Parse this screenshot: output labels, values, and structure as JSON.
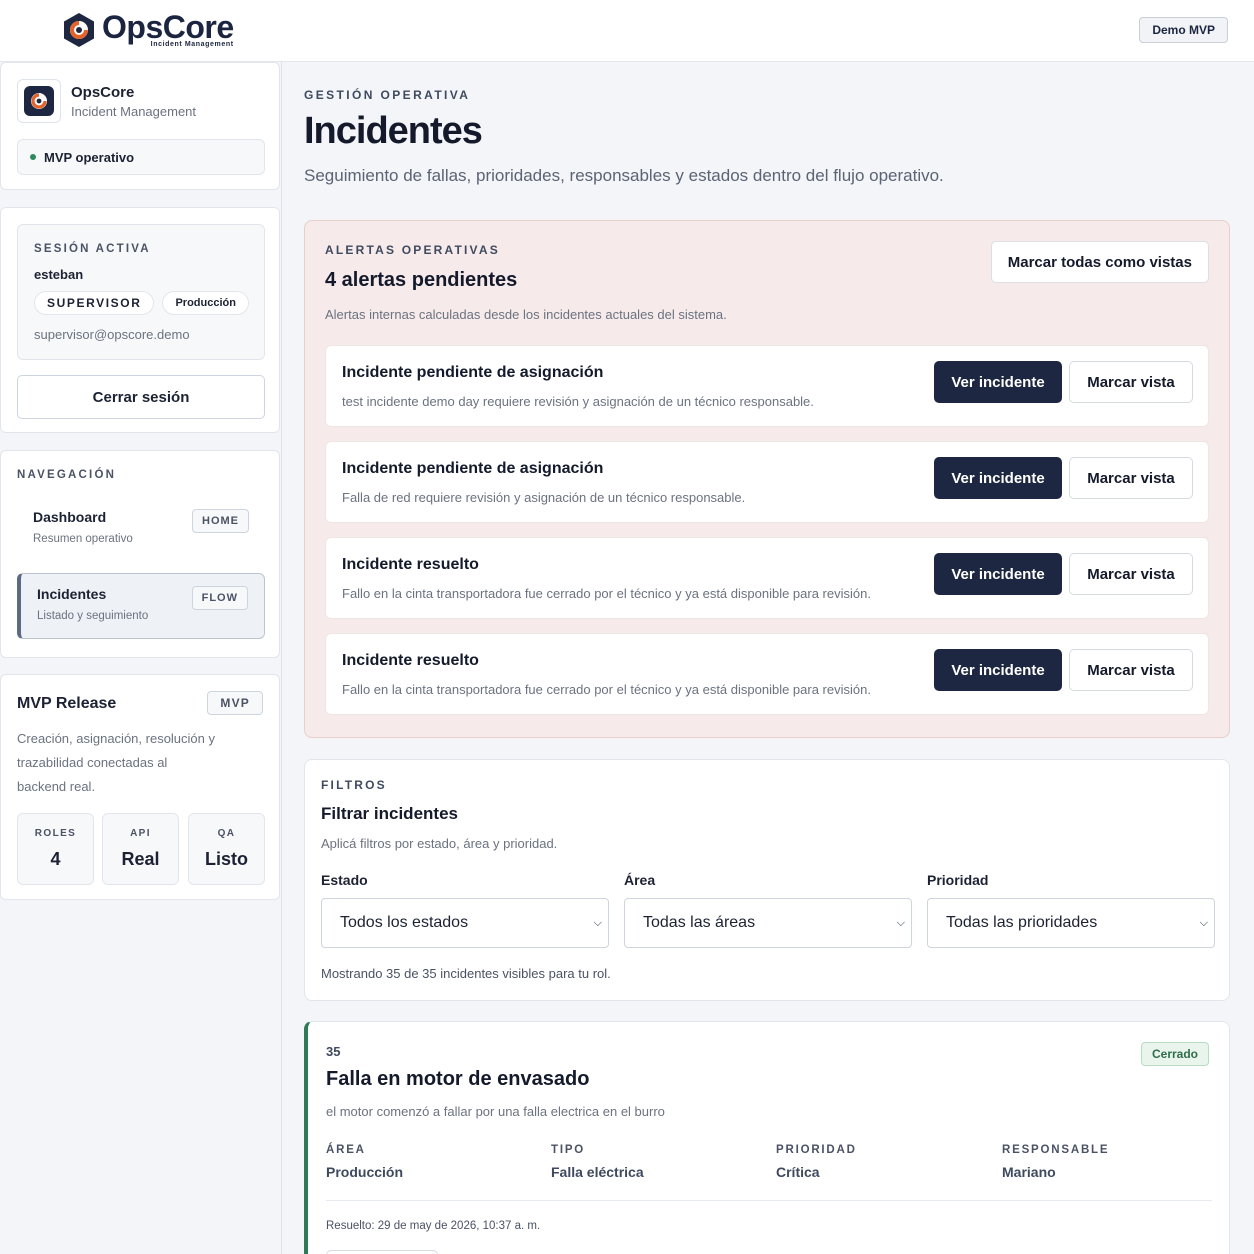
{
  "topbar": {
    "brand_name": "OpsCore",
    "brand_sub": "Incident Management",
    "demo_label": "Demo MVP"
  },
  "sidebar": {
    "app": {
      "name": "OpsCore",
      "desc": "Incident Management",
      "status": "MVP operativo"
    },
    "session": {
      "eyebrow": "SESIÓN ACTIVA",
      "user": "esteban",
      "role": "SUPERVISOR",
      "area": "Producción",
      "email": "supervisor@opscore.demo",
      "logout_label": "Cerrar sesión"
    },
    "nav": {
      "eyebrow": "NAVEGACIÓN",
      "items": [
        {
          "title": "Dashboard",
          "sub": "Resumen operativo",
          "badge": "HOME"
        },
        {
          "title": "Incidentes",
          "sub": "Listado y seguimiento",
          "badge": "FLOW"
        }
      ]
    },
    "release": {
      "title": "MVP Release",
      "badge": "MVP",
      "desc": "Creación, asignación, resolución y trazabilidad conectadas al backend real.",
      "stats": [
        {
          "label": "ROLES",
          "value": "4"
        },
        {
          "label": "API",
          "value": "Real"
        },
        {
          "label": "QA",
          "value": "Listo"
        }
      ]
    }
  },
  "page": {
    "eyebrow": "GESTIÓN OPERATIVA",
    "title": "Incidentes",
    "subtitle": "Seguimiento de fallas, prioridades, responsables y estados dentro del flujo operativo."
  },
  "alerts": {
    "eyebrow": "ALERTAS OPERATIVAS",
    "title": "4 alertas pendientes",
    "subtitle": "Alertas internas calculadas desde los incidentes actuales del sistema.",
    "mark_all_label": "Marcar todas como vistas",
    "view_label": "Ver incidente",
    "mark_label": "Marcar vista",
    "items": [
      {
        "title": "Incidente pendiente de asignación",
        "desc": "test incidente demo day requiere revisión y asignación de un técnico responsable."
      },
      {
        "title": "Incidente pendiente de asignación",
        "desc": "Falla de red requiere revisión y asignación de un técnico responsable."
      },
      {
        "title": "Incidente resuelto",
        "desc": "Fallo en la cinta transportadora fue cerrado por el técnico y ya está disponible para revisión."
      },
      {
        "title": "Incidente resuelto",
        "desc": "Fallo en la cinta transportadora fue cerrado por el técnico y ya está disponible para revisión."
      }
    ]
  },
  "filters": {
    "eyebrow": "FILTROS",
    "title": "Filtrar incidentes",
    "subtitle": "Aplicá filtros por estado, área y prioridad.",
    "fields": [
      {
        "label": "Estado",
        "value": "Todos los estados"
      },
      {
        "label": "Área",
        "value": "Todas las áreas"
      },
      {
        "label": "Prioridad",
        "value": "Todas las prioridades"
      }
    ],
    "count_text": "Mostrando 35 de 35 incidentes visibles para tu rol."
  },
  "incident": {
    "id": "35",
    "title": "Falla en motor de envasado",
    "desc": "el motor comenzó a fallar por una falla electrica en el burro",
    "status": "Cerrado",
    "meta": [
      {
        "label": "ÁREA",
        "value": "Producción"
      },
      {
        "label": "TIPO",
        "value": "Falla eléctrica"
      },
      {
        "label": "PRIORIDAD",
        "value": "Crítica"
      },
      {
        "label": "RESPONSABLE",
        "value": "Mariano"
      }
    ],
    "resolved": "Resuelto: 29 de may de 2026, 10:37 a. m."
  },
  "colors": {
    "primary": "#1d2742",
    "accent_orange": "#e2632b",
    "status_green": "#2f8a5b",
    "alert_bg": "#f6ebea"
  }
}
